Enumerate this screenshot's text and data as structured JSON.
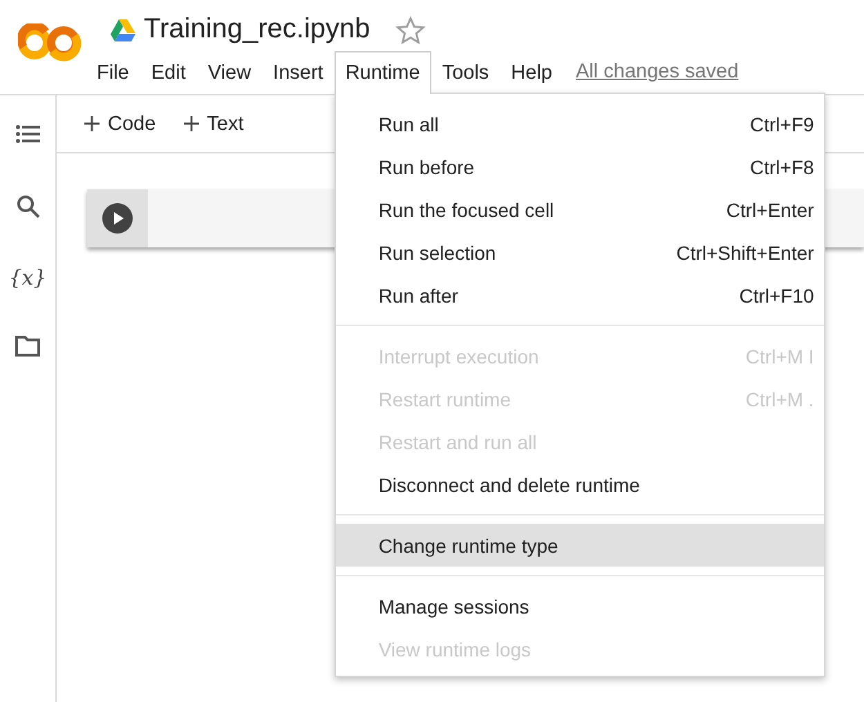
{
  "notebook": {
    "title": "Training_rec.ipynb",
    "starred": false
  },
  "menubar": [
    {
      "label": "File",
      "selected": false
    },
    {
      "label": "Edit",
      "selected": false
    },
    {
      "label": "View",
      "selected": false
    },
    {
      "label": "Insert",
      "selected": false
    },
    {
      "label": "Runtime",
      "selected": true
    },
    {
      "label": "Tools",
      "selected": false
    },
    {
      "label": "Help",
      "selected": false
    }
  ],
  "save_status": "All changes saved",
  "sidebar": {
    "items": [
      {
        "kind": "toc"
      },
      {
        "kind": "search"
      },
      {
        "kind": "variables",
        "label": "{x}"
      },
      {
        "kind": "files"
      }
    ]
  },
  "toolbar": [
    {
      "label": "Code"
    },
    {
      "label": "Text"
    }
  ],
  "cells": [
    {
      "kind": "code"
    }
  ],
  "runtime_menu": {
    "sections": [
      [
        {
          "label": "Run all",
          "shortcut": "Ctrl+F9",
          "disabled": false,
          "highlighted": false
        },
        {
          "label": "Run before",
          "shortcut": "Ctrl+F8",
          "disabled": false,
          "highlighted": false
        },
        {
          "label": "Run the focused cell",
          "shortcut": "Ctrl+Enter",
          "disabled": false,
          "highlighted": false
        },
        {
          "label": "Run selection",
          "shortcut": "Ctrl+Shift+Enter",
          "disabled": false,
          "highlighted": false
        },
        {
          "label": "Run after",
          "shortcut": "Ctrl+F10",
          "disabled": false,
          "highlighted": false
        }
      ],
      [
        {
          "label": "Interrupt execution",
          "shortcut": "Ctrl+M I",
          "disabled": true,
          "highlighted": false
        },
        {
          "label": "Restart runtime",
          "shortcut": "Ctrl+M .",
          "disabled": true,
          "highlighted": false
        },
        {
          "label": "Restart and run all",
          "disabled": true,
          "highlighted": false
        },
        {
          "label": "Disconnect and delete runtime",
          "disabled": false,
          "highlighted": false
        }
      ],
      [
        {
          "label": "Change runtime type",
          "disabled": false,
          "highlighted": true
        }
      ],
      [
        {
          "label": "Manage sessions",
          "disabled": false,
          "highlighted": false
        },
        {
          "label": "View runtime logs",
          "disabled": true,
          "highlighted": false
        }
      ]
    ]
  }
}
